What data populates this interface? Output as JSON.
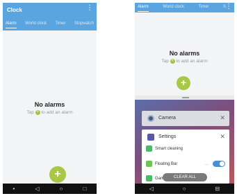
{
  "left_phone": {
    "app_title": "Clock",
    "menu_icon": "more-vert-icon",
    "tabs": [
      {
        "label": "Alarm",
        "active": true
      },
      {
        "label": "World clock",
        "active": false
      },
      {
        "label": "Timer",
        "active": false
      },
      {
        "label": "Stopwatch",
        "active": false
      }
    ],
    "empty_title": "No alarms",
    "empty_hint_prefix": "Tap",
    "empty_hint_suffix": "to add an alarm",
    "fab_glyph": "+",
    "nav": [
      "•",
      "◁",
      "○",
      "□"
    ]
  },
  "right_phone": {
    "tabs": [
      {
        "label": "Alarm",
        "active": true
      },
      {
        "label": "World clock",
        "active": false
      },
      {
        "label": "Timer",
        "active": false
      },
      {
        "label": "S",
        "active": false
      }
    ],
    "menu_glyph": "⋮",
    "empty_title": "No alarms",
    "empty_hint_prefix": "Tap",
    "empty_hint_suffix": "to add an alarm",
    "fab_glyph": "+",
    "recents": {
      "camera_label": "Camera",
      "settings_label": "Settings",
      "close_glyph": "✕",
      "items": {
        "smart_cleaning": "Smart cleaning",
        "floating_bar": "Floating Bar",
        "gaming": "Gaming"
      },
      "floating_bar_enabled": true,
      "more_glyph": "···",
      "clear_all_label": "CLEAR ALL"
    },
    "nav": [
      "◁",
      "○",
      "⊟"
    ]
  },
  "colors": {
    "header_blue": "#5aa4df",
    "fab_green": "#a8c744",
    "toggle_blue": "#4a8fd3"
  }
}
